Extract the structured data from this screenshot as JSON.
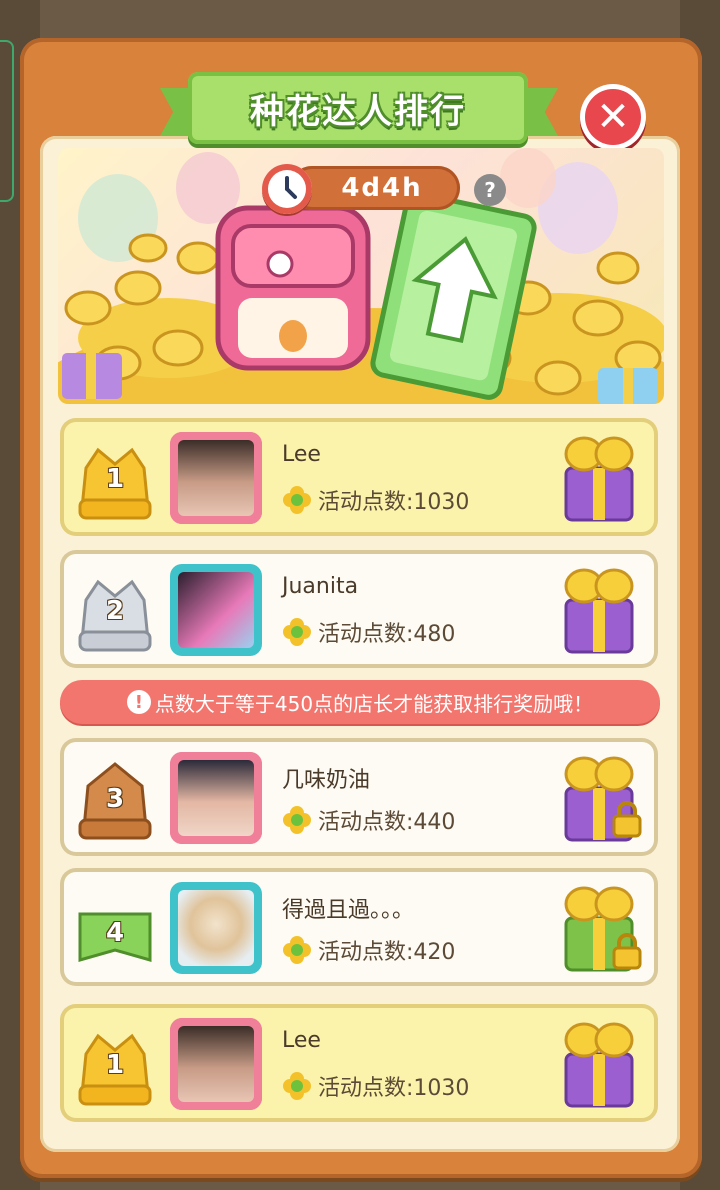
{
  "title": "种花达人排行",
  "timer": {
    "remaining": "4d4h",
    "help": "?"
  },
  "notice": {
    "icon": "!",
    "text": "点数大于等于450点的店长才能获取排行奖励哦！"
  },
  "colors": {
    "panel": "#d8823c",
    "ribbon": "#a9df6b",
    "close": "#e8474e",
    "notice": "#f2766e",
    "row_highlight": "#fbf3ab",
    "gift_purple": "#9b5fd0",
    "gift_green": "#7fc24a"
  },
  "rows": [
    {
      "rank": "1",
      "badge": "gold-crown-badge",
      "name": "Lee",
      "points": "活动点数:1030",
      "gift": "purple-gift-icon",
      "locked": false
    },
    {
      "rank": "2",
      "badge": "silver-crown-badge",
      "name": "Juanita",
      "points": "活动点数:480",
      "gift": "purple-gift-icon",
      "locked": false
    },
    {
      "rank": "3",
      "badge": "bronze-badge",
      "name": "几味奶油",
      "points": "活动点数:440",
      "gift": "purple-gift-icon",
      "locked": true
    },
    {
      "rank": "4",
      "badge": "green-flag-badge",
      "name": "得過且過。。。",
      "points": "活动点数:420",
      "gift": "green-gift-icon",
      "locked": true
    },
    {
      "rank": "1",
      "badge": "gold-crown-badge",
      "name": "Lee",
      "points": "活动点数:1030",
      "gift": "purple-gift-icon",
      "locked": false
    }
  ]
}
